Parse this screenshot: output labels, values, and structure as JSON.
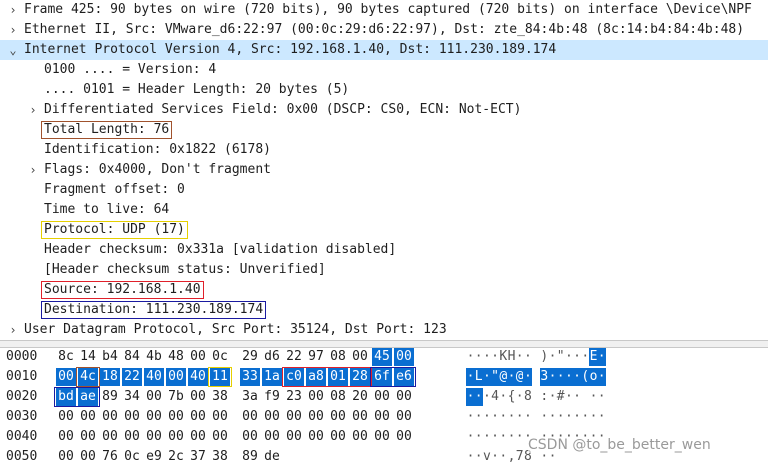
{
  "tree": [
    {
      "text": "Frame 425: 90 bytes on wire (720 bits), 90 bytes captured (720 bits) on interface \\Device\\NPF",
      "arrow": ">",
      "indent": 0
    },
    {
      "text": "Ethernet II, Src: VMware_d6:22:97 (00:0c:29:d6:22:97), Dst: zte_84:4b:48 (8c:14:b4:84:4b:48)",
      "arrow": ">",
      "indent": 0
    },
    {
      "text": "Internet Protocol Version 4, Src: 192.168.1.40, Dst: 111.230.189.174",
      "arrow": "v",
      "indent": 0,
      "selected": true
    },
    {
      "text": "0100 .... = Version: 4",
      "arrow": "",
      "indent": 1
    },
    {
      "text": ".... 0101 = Header Length: 20 bytes (5)",
      "arrow": "",
      "indent": 1
    },
    {
      "text": "Differentiated Services Field: 0x00 (DSCP: CS0, ECN: Not-ECT)",
      "arrow": ">",
      "indent": 1
    },
    {
      "text": "Total Length: 76",
      "arrow": "",
      "indent": 1,
      "box": "brown"
    },
    {
      "text": "Identification: 0x1822 (6178)",
      "arrow": "",
      "indent": 1
    },
    {
      "text": "Flags: 0x4000, Don't fragment",
      "arrow": ">",
      "indent": 1
    },
    {
      "text": "Fragment offset: 0",
      "arrow": "",
      "indent": 1
    },
    {
      "text": "Time to live: 64",
      "arrow": "",
      "indent": 1
    },
    {
      "text": "Protocol: UDP (17)",
      "arrow": "",
      "indent": 1,
      "box": "yellow"
    },
    {
      "text": "Header checksum: 0x331a [validation disabled]",
      "arrow": "",
      "indent": 1
    },
    {
      "text": "[Header checksum status: Unverified]",
      "arrow": "",
      "indent": 1
    },
    {
      "text": "Source: 192.168.1.40",
      "arrow": "",
      "indent": 1,
      "box": "red"
    },
    {
      "text": "Destination: 111.230.189.174",
      "arrow": "",
      "indent": 1,
      "box": "blue"
    },
    {
      "text": "User Datagram Protocol, Src Port: 35124, Dst Port: 123",
      "arrow": ">",
      "indent": 0
    }
  ],
  "hex": [
    {
      "offset": "0000",
      "bytes": [
        "8c",
        "14",
        "b4",
        "84",
        "4b",
        "48",
        "00",
        "0c",
        "29",
        "d6",
        "22",
        "97",
        "08",
        "00",
        "45",
        "00"
      ],
      "ascii": "····KH·· )·\"···E·",
      "sel_from": 14
    },
    {
      "offset": "0010",
      "bytes": [
        "00",
        "4c",
        "18",
        "22",
        "40",
        "00",
        "40",
        "11",
        "33",
        "1a",
        "c0",
        "a8",
        "01",
        "28",
        "6f",
        "e6"
      ],
      "ascii": "·L·\"@·@· 3····(o·",
      "sel_from": 0
    },
    {
      "offset": "0020",
      "bytes": [
        "bd",
        "ae",
        "89",
        "34",
        "00",
        "7b",
        "00",
        "38",
        "3a",
        "f9",
        "23",
        "00",
        "08",
        "20",
        "00",
        "00"
      ],
      "ascii": "···4·{·8 :·#·· ··",
      "sel_to": 2
    },
    {
      "offset": "0030",
      "bytes": [
        "00",
        "00",
        "00",
        "00",
        "00",
        "00",
        "00",
        "00",
        "00",
        "00",
        "00",
        "00",
        "00",
        "00",
        "00",
        "00"
      ],
      "ascii": "········ ········"
    },
    {
      "offset": "0040",
      "bytes": [
        "00",
        "00",
        "00",
        "00",
        "00",
        "00",
        "00",
        "00",
        "00",
        "00",
        "00",
        "00",
        "00",
        "00",
        "00",
        "00"
      ],
      "ascii": "········ ········"
    },
    {
      "offset": "0050",
      "bytes": [
        "00",
        "00",
        "76",
        "0c",
        "e9",
        "2c",
        "37",
        "38",
        "89",
        "de"
      ],
      "ascii": "··v··,78 ··"
    }
  ],
  "watermark": "CSDN @to_be_better_wen",
  "colors": {
    "selected_row": "#cce8ff",
    "selected_bytes": "#0a6ed1",
    "box_brown": "#a0522d",
    "box_yellow": "#e6d000",
    "box_red": "#e0202a",
    "box_blue": "#1a1aa0"
  }
}
